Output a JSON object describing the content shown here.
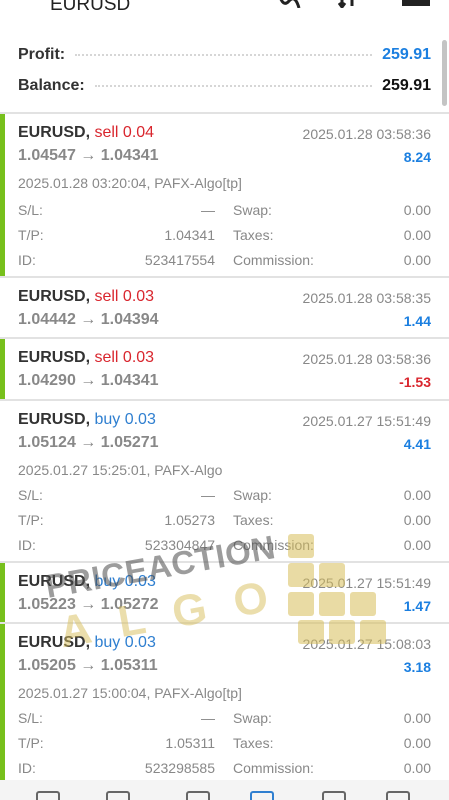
{
  "header": {
    "title": "EURUSD"
  },
  "summary": {
    "profit_label": "Profit:",
    "profit_value": "259.91",
    "balance_label": "Balance:",
    "balance_value": "259.91"
  },
  "trades": [
    {
      "symbol": "EURUSD,",
      "side": "sell 0.04",
      "close_time": "2025.01.28 03:58:36",
      "prices": "1.04547 → 1.04341",
      "profit": "8.24",
      "open_info": "2025.01.28 03:20:04, PAFX-Algo[tp]",
      "sl_label": "S/L:",
      "sl": "—",
      "tp_label": "T/P:",
      "tp": "1.04341",
      "id_label": "ID:",
      "id": "523417554",
      "swap_label": "Swap:",
      "swap": "0.00",
      "taxes_label": "Taxes:",
      "taxes": "0.00",
      "comm_label": "Commission:",
      "comm": "0.00"
    },
    {
      "symbol": "EURUSD,",
      "side": "sell 0.03",
      "close_time": "2025.01.28 03:58:35",
      "prices": "1.04442 → 1.04394",
      "profit": "1.44"
    },
    {
      "symbol": "EURUSD,",
      "side": "sell 0.03",
      "close_time": "2025.01.28 03:58:36",
      "prices": "1.04290 → 1.04341",
      "profit": "-1.53"
    },
    {
      "symbol": "EURUSD,",
      "side": "buy 0.03",
      "close_time": "2025.01.27 15:51:49",
      "prices": "1.05124 → 1.05271",
      "profit": "4.41",
      "open_info": "2025.01.27 15:25:01, PAFX-Algo",
      "sl_label": "S/L:",
      "sl": "—",
      "tp_label": "T/P:",
      "tp": "1.05273",
      "id_label": "ID:",
      "id": "523304847",
      "swap_label": "Swap:",
      "swap": "0.00",
      "taxes_label": "Taxes:",
      "taxes": "0.00",
      "comm_label": "Commission:",
      "comm": "0.00"
    },
    {
      "symbol": "EURUSD,",
      "side": "buy 0.03",
      "close_time": "2025.01.27 15:51:49",
      "prices": "1.05223 → 1.05272",
      "profit": "1.47"
    },
    {
      "symbol": "EURUSD,",
      "side": "buy 0.03",
      "close_time": "2025.01.27 15:08:03",
      "prices": "1.05205 → 1.05311",
      "profit": "3.18",
      "open_info": "2025.01.27 15:00:04, PAFX-Algo[tp]",
      "sl_label": "S/L:",
      "sl": "—",
      "tp_label": "T/P:",
      "tp": "1.05311",
      "id_label": "ID:",
      "id": "523298585",
      "swap_label": "Swap:",
      "swap": "0.00",
      "taxes_label": "Taxes:",
      "taxes": "0.00",
      "comm_label": "Commission:",
      "comm": "0.00"
    }
  ],
  "watermark": {
    "line1": "PRICEACTION",
    "line2": "ALGO"
  },
  "colors": {
    "sell": "#d9262e",
    "buy": "#2f7fd0",
    "positive": "#1b7fe0",
    "negative": "#d9262e",
    "indicator": "#77c01c"
  },
  "icons": [
    "menu-icon",
    "chart-icon",
    "sort-icon",
    "calendar-icon"
  ]
}
